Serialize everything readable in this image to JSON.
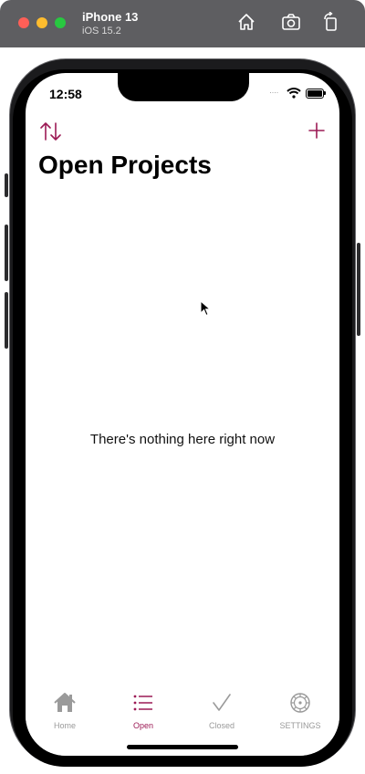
{
  "simulator": {
    "device_name": "iPhone 13",
    "os_version": "iOS 15.2",
    "home_icon": "home-icon",
    "screenshot_icon": "camera-icon",
    "rotate_icon": "rotate-icon"
  },
  "status_bar": {
    "time": "12:58",
    "signal": "····",
    "wifi_icon": "wifi-icon",
    "battery_icon": "battery-icon"
  },
  "nav": {
    "sort_icon": "sort-arrows-icon",
    "add_icon": "plus-icon",
    "title": "Open Projects"
  },
  "main": {
    "empty_message": "There's nothing here right now"
  },
  "tabs": [
    {
      "label": "Home",
      "icon": "house-icon",
      "active": false
    },
    {
      "label": "Open",
      "icon": "list-icon",
      "active": true
    },
    {
      "label": "Closed",
      "icon": "checkmark-icon",
      "active": false
    },
    {
      "label": "SETTINGS",
      "icon": "gear-icon",
      "active": false
    }
  ],
  "colors": {
    "accent": "#9c1a55",
    "inactive": "#9a9a9a",
    "sim_bar": "#5e5e61"
  }
}
